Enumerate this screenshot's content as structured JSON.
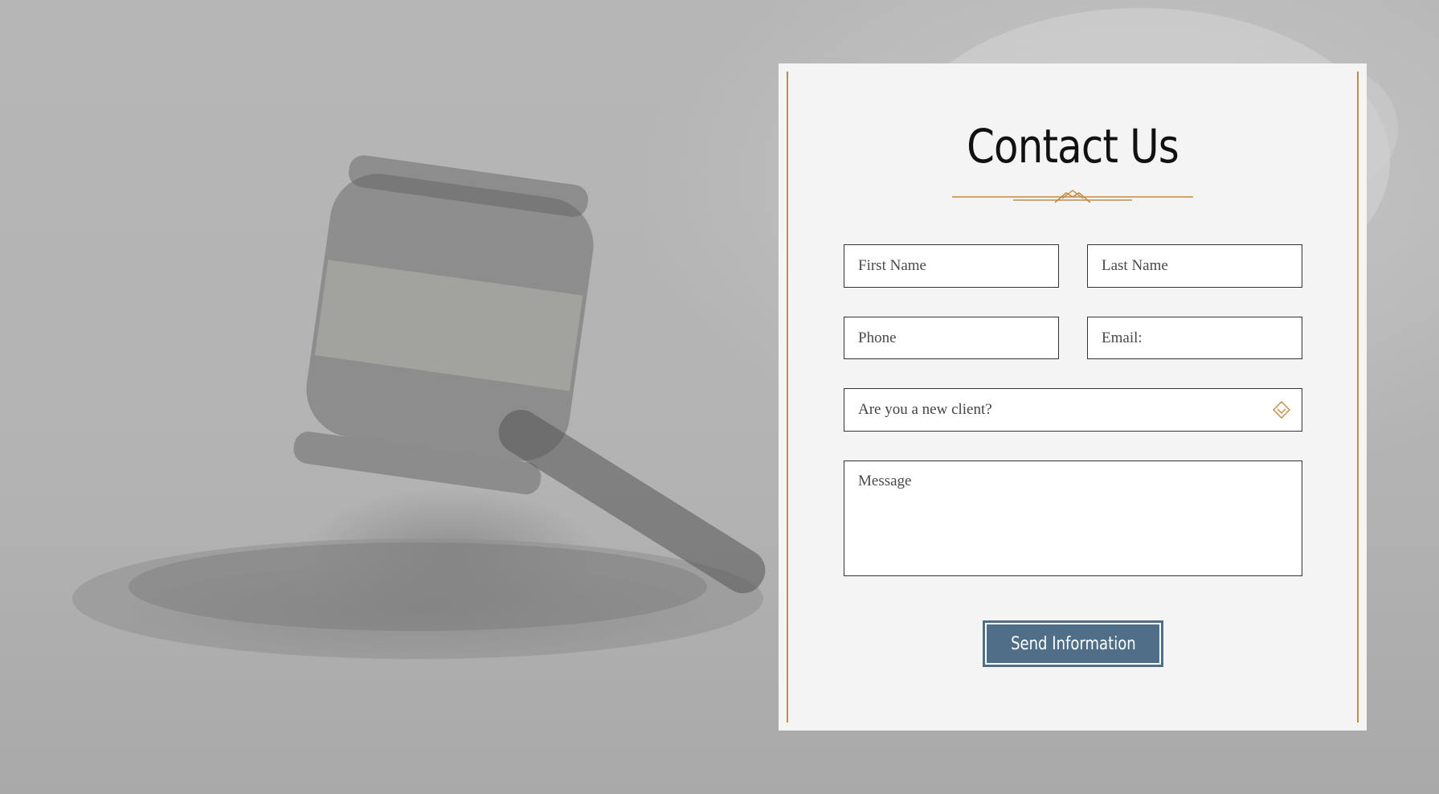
{
  "contact": {
    "title": "Contact Us",
    "first_name_placeholder": "First Name",
    "last_name_placeholder": "Last Name",
    "phone_placeholder": "Phone",
    "email_placeholder": "Email:",
    "new_client_placeholder": "Are you a new client?",
    "message_placeholder": "Message",
    "submit_label": "Send Information"
  },
  "colors": {
    "accent": "#c38b3f",
    "button": "#4f6e87",
    "card": "#f4f4f4",
    "backdrop": "#b4b4b4"
  },
  "icons": {
    "title_ornament": "gold-divider-ornament",
    "select_arrow": "diamond-chevron-down-icon"
  }
}
